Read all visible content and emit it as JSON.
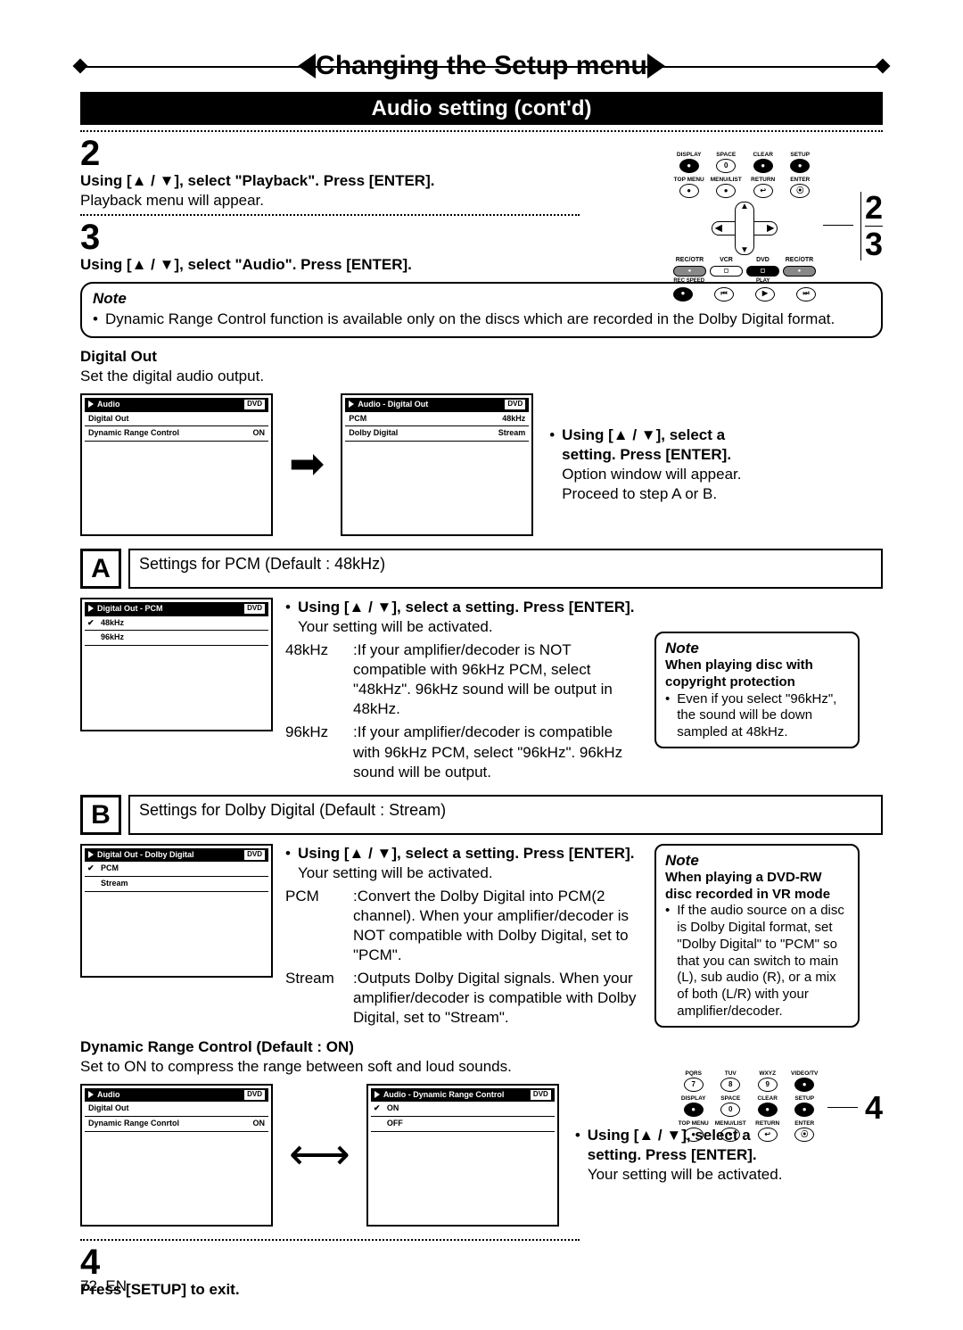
{
  "header": {
    "title": "Changing the Setup menu",
    "subtitle": "Audio setting (cont'd)"
  },
  "steps": {
    "s2": {
      "num": "2",
      "bold": "Using [▲ / ▼], select \"Playback\". Press [ENTER].",
      "text": "Playback menu will appear."
    },
    "s3": {
      "num": "3",
      "bold": "Using [▲ / ▼], select \"Audio\". Press [ENTER]."
    },
    "s4": {
      "num": "4",
      "bold": "Press [SETUP] to exit."
    }
  },
  "note_main": {
    "label": "Note",
    "body": "Dynamic Range Control function is available only on the discs which are recorded in the Dolby Digital format."
  },
  "digital_out": {
    "heading": "Digital Out",
    "desc": "Set the digital audio output.",
    "screen_left": {
      "title": "Audio",
      "tag": "DVD",
      "rows": [
        {
          "k": "Digital Out",
          "v": ""
        },
        {
          "k": "Dynamic Range Control",
          "v": "ON"
        }
      ]
    },
    "screen_right": {
      "title": "Audio - Digital Out",
      "tag": "DVD",
      "rows": [
        {
          "k": "PCM",
          "v": "48kHz"
        },
        {
          "k": "Dolby Digital",
          "v": "Stream"
        }
      ]
    },
    "side_text": {
      "bold": "Using [▲ / ▼], select a setting. Press [ENTER].",
      "body1": "Option window will appear.",
      "body2": "Proceed to step A or B."
    }
  },
  "sectionA": {
    "letter": "A",
    "title": "Settings for PCM (Default : 48kHz)",
    "screen": {
      "title": "Digital Out - PCM",
      "tag": "DVD",
      "rows": [
        {
          "k": "48kHz",
          "checked": true
        },
        {
          "k": "96kHz"
        }
      ]
    },
    "bullet_bold": "Using [▲ / ▼], select a setting. Press [ENTER].",
    "bullet_text": "Your setting will be activated.",
    "defs": [
      {
        "k": "48kHz",
        "v": ":If your amplifier/decoder is NOT compatible with 96kHz PCM, select \"48kHz\". 96kHz sound will be output in 48kHz."
      },
      {
        "k": "96kHz",
        "v": ":If your amplifier/decoder is compatible with 96kHz PCM, select \"96kHz\". 96kHz sound will be output."
      }
    ],
    "note": {
      "label": "Note",
      "bold": "When playing disc with copyright protection",
      "body": "Even if you select \"96kHz\", the sound will be down sampled at 48kHz."
    }
  },
  "sectionB": {
    "letter": "B",
    "title": "Settings for Dolby Digital (Default : Stream)",
    "screen": {
      "title": "Digital Out - Dolby Digital",
      "tag": "DVD",
      "rows": [
        {
          "k": "PCM",
          "checked": true
        },
        {
          "k": "Stream"
        }
      ]
    },
    "bullet_bold": "Using [▲ / ▼], select a setting. Press [ENTER].",
    "bullet_text": "Your setting will be activated.",
    "defs": [
      {
        "k": "PCM",
        "v": ":Convert the Dolby Digital into PCM(2 channel). When your amplifier/decoder is NOT compatible with Dolby Digital, set to \"PCM\"."
      },
      {
        "k": "Stream",
        "v": ":Outputs Dolby Digital signals. When your amplifier/decoder is compatible with Dolby Digital, set to \"Stream\"."
      }
    ],
    "note": {
      "label": "Note",
      "bold": "When playing a DVD-RW disc recorded in VR mode",
      "body": "If the audio source on a disc is Dolby Digital format, set \"Dolby Digital\" to \"PCM\" so that you can switch to main (L), sub audio (R), or a mix of both (L/R) with your amplifier/decoder."
    }
  },
  "drc": {
    "heading": "Dynamic Range Control (Default : ON)",
    "desc": "Set to ON to compress the range between soft and loud sounds.",
    "screen_left": {
      "title": "Audio",
      "tag": "DVD",
      "rows": [
        {
          "k": "Digital Out",
          "v": ""
        },
        {
          "k": "Dynamic Range Conrtol",
          "v": "ON"
        }
      ]
    },
    "screen_right": {
      "title": "Audio - Dynamic Range Control",
      "tag": "DVD",
      "rows": [
        {
          "k": "ON",
          "checked": true
        },
        {
          "k": "OFF"
        }
      ]
    },
    "side_text": {
      "bold": "Using [▲ / ▼], select a setting. Press [ENTER].",
      "body": "Your setting will be activated."
    }
  },
  "remote_top": {
    "row1": [
      "DISPLAY",
      "SPACE",
      "CLEAR",
      "SETUP"
    ],
    "btn1": [
      "●",
      "0",
      "●",
      "●"
    ],
    "row2": [
      "TOP MENU",
      "MENU/LIST",
      "RETURN",
      "ENTER"
    ],
    "btn2": [
      "●",
      "●",
      "↩",
      "⦿"
    ],
    "modes": [
      "REC/OTR",
      "VCR",
      "DVD",
      "REC/OTR"
    ],
    "row3": [
      "REC SPEED",
      "",
      "PLAY",
      ""
    ],
    "transport": [
      "●",
      "⏮",
      "▶",
      "⏭"
    ],
    "callouts": [
      "2",
      "3"
    ]
  },
  "remote_bot": {
    "rowA": [
      "PQRS",
      "TUV",
      "WXYZ",
      "VIDEO/TV"
    ],
    "btnA": [
      "7",
      "8",
      "9",
      "●"
    ],
    "rowB": [
      "DISPLAY",
      "SPACE",
      "CLEAR",
      "SETUP"
    ],
    "btnB": [
      "●",
      "0",
      "●",
      "●"
    ],
    "rowC": [
      "TOP MENU",
      "MENU/LIST",
      "RETURN",
      "ENTER"
    ],
    "btnC": [
      "●",
      "●",
      "↩",
      "⦿"
    ],
    "callouts": [
      "4"
    ]
  },
  "footer": {
    "page": "72",
    "lang": "EN"
  }
}
